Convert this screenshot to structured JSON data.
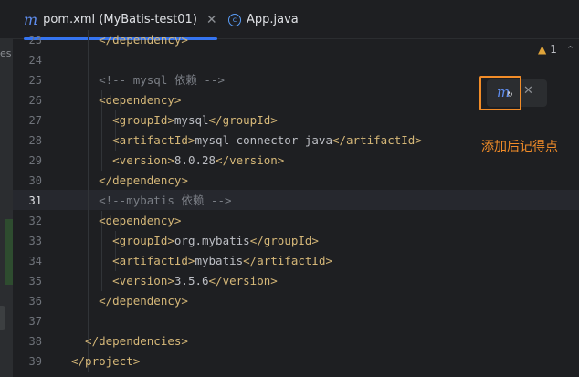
{
  "tabs": [
    {
      "label": "pom.xml (MyBatis-test01)",
      "icon": "maven-icon",
      "active": true
    },
    {
      "label": "App.java",
      "icon": "java-class-icon",
      "active": false
    }
  ],
  "left_strip_fragment": "es",
  "inspection": {
    "count": "1",
    "icon": "warning-icon"
  },
  "popup": {
    "button_icon": "maven-load-changes-icon",
    "close_icon": "close-icon"
  },
  "annotation": "添加后记得点",
  "current_line": "31",
  "colors": {
    "tag": "#d5b778",
    "text": "#bcbec4",
    "comment": "#7a7e85",
    "accent": "#3574f0",
    "highlight": "#f28c28"
  },
  "lines": [
    {
      "n": "23",
      "parts": [
        [
          "tag",
          "    </dependency>"
        ]
      ]
    },
    {
      "n": "24",
      "parts": []
    },
    {
      "n": "25",
      "parts": [
        [
          "cmt",
          "    <!-- mysql 依赖 -->"
        ]
      ]
    },
    {
      "n": "26",
      "parts": [
        [
          "tag",
          "    <dependency>"
        ]
      ]
    },
    {
      "n": "27",
      "parts": [
        [
          "tag",
          "      <groupId>"
        ],
        [
          "txt",
          "mysql"
        ],
        [
          "tag",
          "</groupId>"
        ]
      ]
    },
    {
      "n": "28",
      "parts": [
        [
          "tag",
          "      <artifactId>"
        ],
        [
          "txt",
          "mysql-connector-java"
        ],
        [
          "tag",
          "</artifactId>"
        ]
      ]
    },
    {
      "n": "29",
      "parts": [
        [
          "tag",
          "      <version>"
        ],
        [
          "txt",
          "8.0.28"
        ],
        [
          "tag",
          "</version>"
        ]
      ]
    },
    {
      "n": "30",
      "parts": [
        [
          "tag",
          "    </dependency>"
        ]
      ]
    },
    {
      "n": "31",
      "parts": [
        [
          "cmt",
          "    <!--mybatis 依赖 -->"
        ]
      ]
    },
    {
      "n": "32",
      "parts": [
        [
          "tag",
          "    <dependency>"
        ]
      ]
    },
    {
      "n": "33",
      "parts": [
        [
          "tag",
          "      <groupId>"
        ],
        [
          "txt",
          "org.mybatis"
        ],
        [
          "tag",
          "</groupId>"
        ]
      ]
    },
    {
      "n": "34",
      "parts": [
        [
          "tag",
          "      <artifactId>"
        ],
        [
          "txt",
          "mybatis"
        ],
        [
          "tag",
          "</artifactId>"
        ]
      ]
    },
    {
      "n": "35",
      "parts": [
        [
          "tag",
          "      <version>"
        ],
        [
          "txt",
          "3.5.6"
        ],
        [
          "tag",
          "</version>"
        ]
      ]
    },
    {
      "n": "36",
      "parts": [
        [
          "tag",
          "    </dependency>"
        ]
      ]
    },
    {
      "n": "37",
      "parts": []
    },
    {
      "n": "38",
      "parts": [
        [
          "tag",
          "  </dependencies>"
        ]
      ]
    },
    {
      "n": "39",
      "parts": [
        [
          "tag",
          "</project>"
        ]
      ]
    }
  ]
}
